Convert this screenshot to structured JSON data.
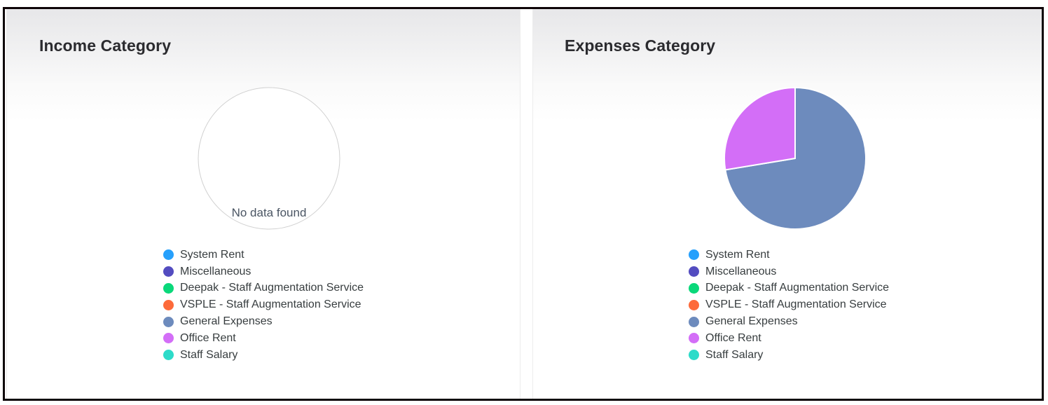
{
  "legend_colors": {
    "System Rent": "#26a0fc",
    "Miscellaneous": "#534cc0",
    "Deepak - Staff Augmentation Service": "#0ad87a",
    "VSPLE - Staff Augmentation Service": "#fd6a3a",
    "General Expenses": "#6d8bbd",
    "Office Rent": "#d36ef7",
    "Staff Salary": "#2ddbc9"
  },
  "chart_data": [
    {
      "type": "pie",
      "title": "Income Category",
      "categories": [
        "System Rent",
        "Miscellaneous",
        "Deepak - Staff Augmentation Service",
        "VSPLE - Staff Augmentation Service",
        "General Expenses",
        "Office Rent",
        "Staff Salary"
      ],
      "values": [
        0,
        0,
        0,
        0,
        0,
        0,
        0
      ],
      "no_data_text": "No data found",
      "legend_position": "bottom"
    },
    {
      "type": "pie",
      "title": "Expenses Category",
      "categories": [
        "System Rent",
        "Miscellaneous",
        "Deepak - Staff Augmentation Service",
        "VSPLE - Staff Augmentation Service",
        "General Expenses",
        "Office Rent",
        "Staff Salary"
      ],
      "values": [
        0,
        0,
        0,
        0,
        72.4,
        27.6,
        0
      ],
      "value_unit": "percent (estimated from slice angles)",
      "legend_position": "bottom"
    }
  ]
}
